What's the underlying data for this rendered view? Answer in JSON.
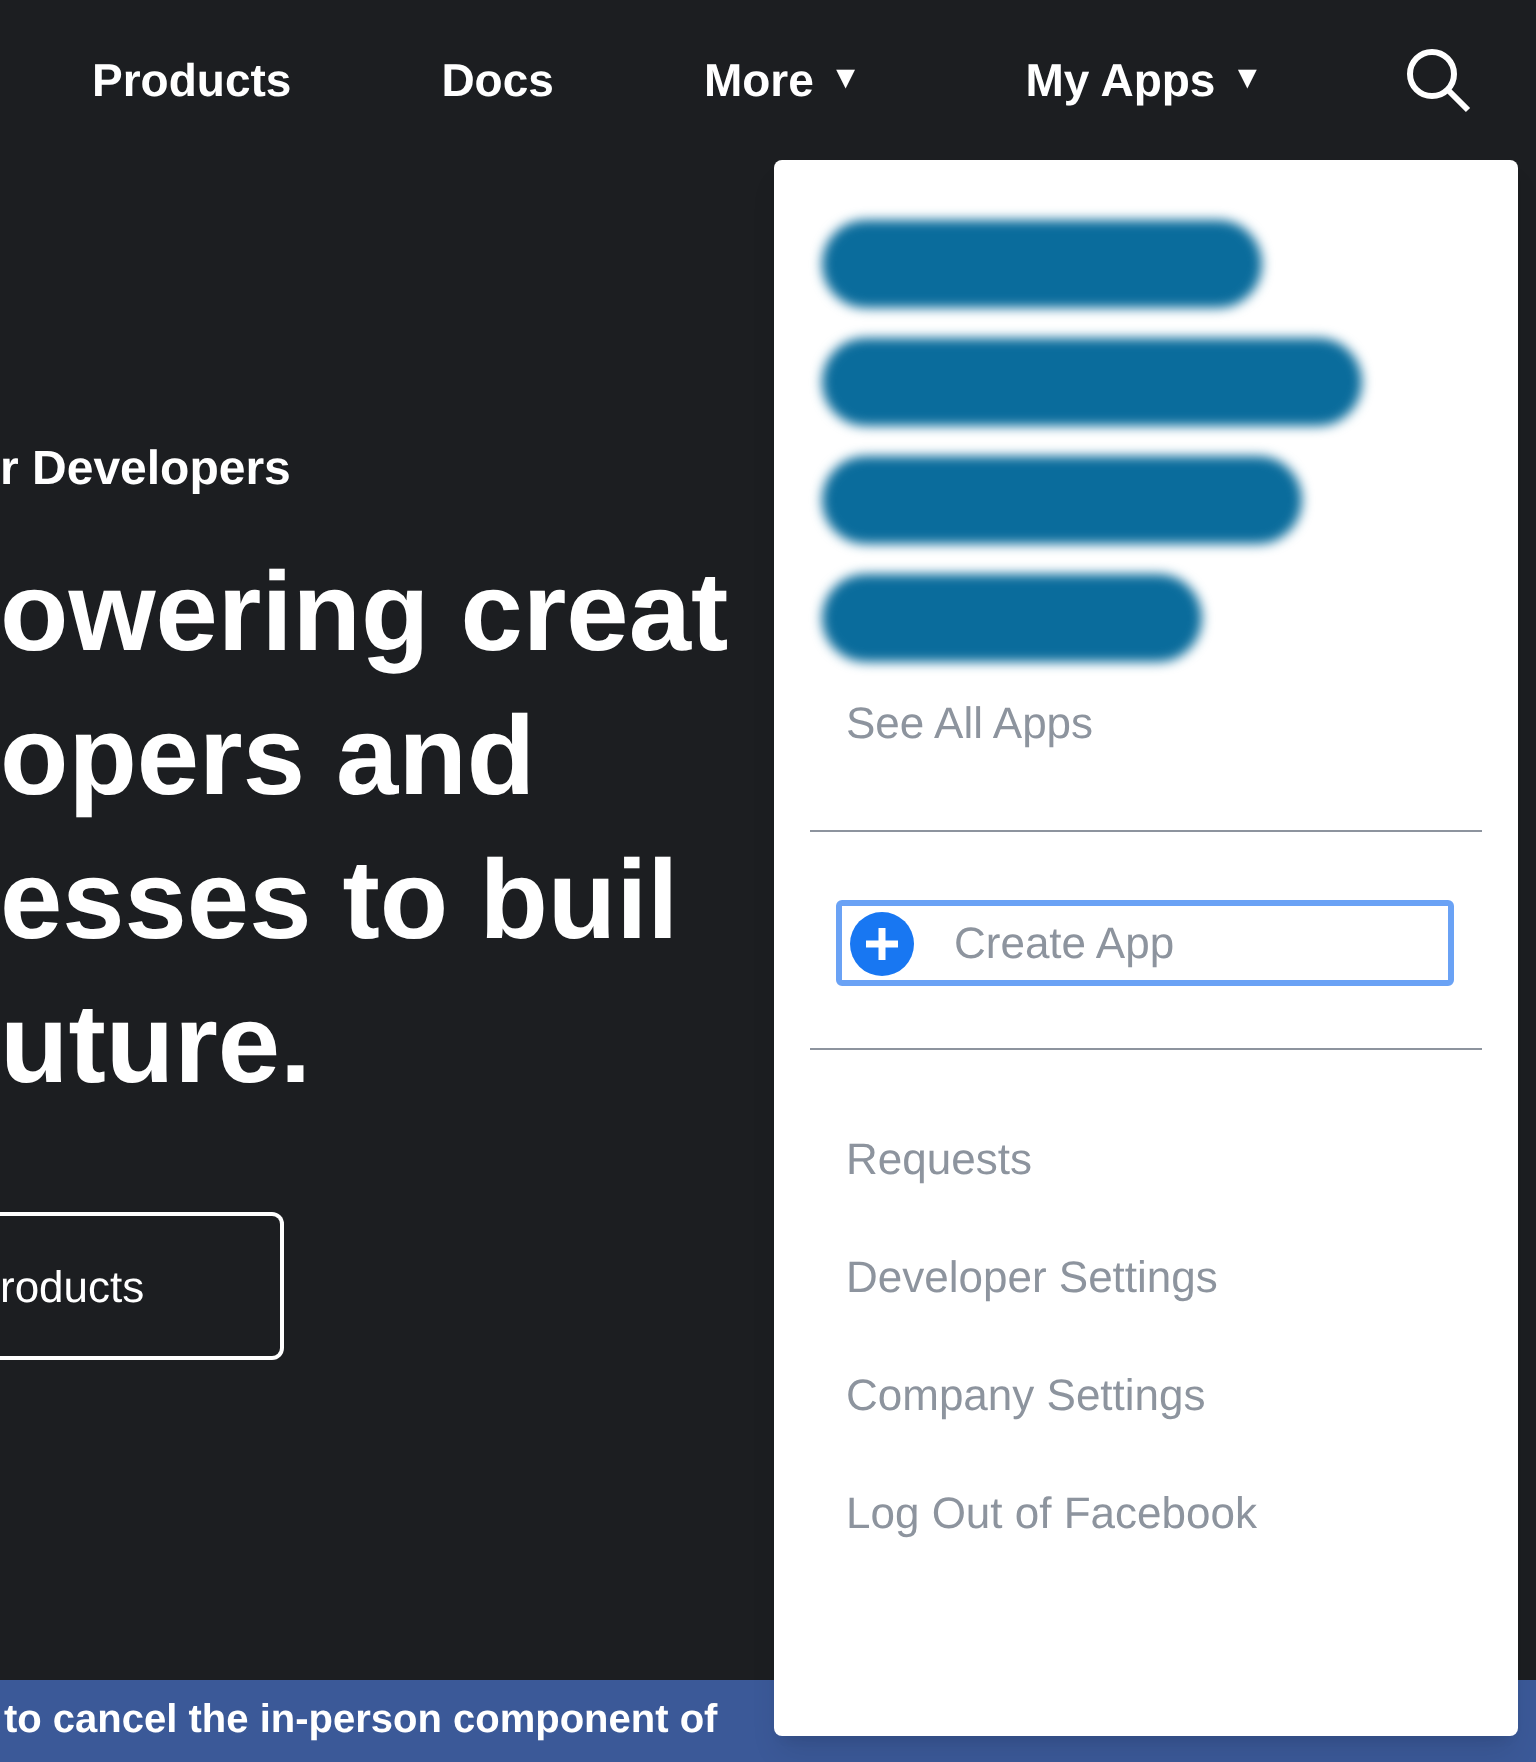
{
  "nav": {
    "items": [
      {
        "label": "Products",
        "dropdown": false
      },
      {
        "label": "Docs",
        "dropdown": false
      },
      {
        "label": "More",
        "dropdown": true,
        "caret": "▼"
      },
      {
        "label": "My Apps",
        "dropdown": true,
        "caret": "▼"
      }
    ]
  },
  "hero": {
    "eyebrow": "r Developers",
    "headline": [
      "owering creat",
      "opers and",
      "esses to buil",
      "uture."
    ],
    "button": "roducts"
  },
  "banner": {
    "text": "to cancel the in-person component of"
  },
  "menu": {
    "apps": [
      {
        "kind": "redacted"
      },
      {
        "kind": "redacted"
      },
      {
        "kind": "redacted"
      },
      {
        "kind": "redacted"
      }
    ],
    "see_all": "See All Apps",
    "create": {
      "label": "Create App",
      "focused": true
    },
    "links": [
      "Requests",
      "Developer Settings",
      "Company Settings",
      "Log Out of Facebook"
    ]
  }
}
